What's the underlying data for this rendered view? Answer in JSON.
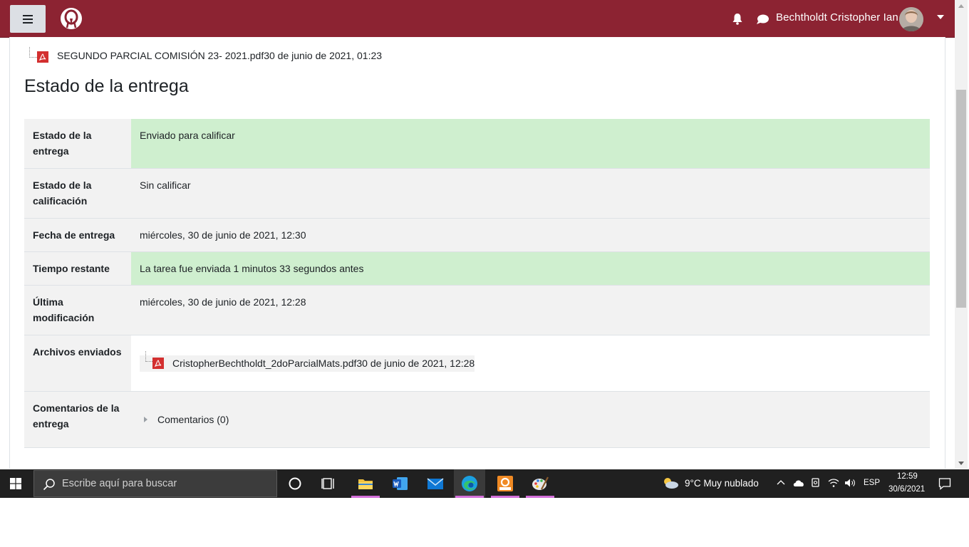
{
  "navbar": {
    "user_name": "Bechtholdt Cristopher Ian",
    "brand_color": "#8c2332"
  },
  "top_file": {
    "name": "SEGUNDO PARCIAL COMISIÓN 23- 2021.pdf",
    "date": "30 de junio de 2021, 01:23"
  },
  "section_title": "Estado de la entrega",
  "status_rows": [
    {
      "label": "Estado de la entrega",
      "value": "Enviado para calificar"
    },
    {
      "label": "Estado de la calificación",
      "value": "Sin calificar"
    },
    {
      "label": "Fecha de entrega",
      "value": "miércoles, 30 de junio de 2021, 12:30"
    },
    {
      "label": "Tiempo restante",
      "value": "La tarea fue enviada 1 minutos 33 segundos antes"
    },
    {
      "label": "Última modificación",
      "value": "miércoles, 30 de junio de 2021, 12:28"
    },
    {
      "label": "Archivos enviados",
      "file_name": "CristopherBechtholdt_2doParcialMats.pdf",
      "file_date": "30 de junio de 2021, 12:28"
    },
    {
      "label": "Comentarios de la entrega",
      "comments_link": "Comentarios (0)"
    }
  ],
  "status_colors": {
    "success": "#cfefcf",
    "neutral": "#f2f2f2"
  },
  "taskbar": {
    "search_placeholder": "Escribe aquí para buscar",
    "weather": "9°C  Muy nublado",
    "language": "ESP",
    "time": "12:59",
    "date": "30/6/2021",
    "apps": [
      "cortana-icon",
      "task-view-icon",
      "file-explorer-icon",
      "word-icon",
      "mail-icon",
      "edge-icon",
      "pdf-app-icon",
      "paint-icon"
    ]
  }
}
